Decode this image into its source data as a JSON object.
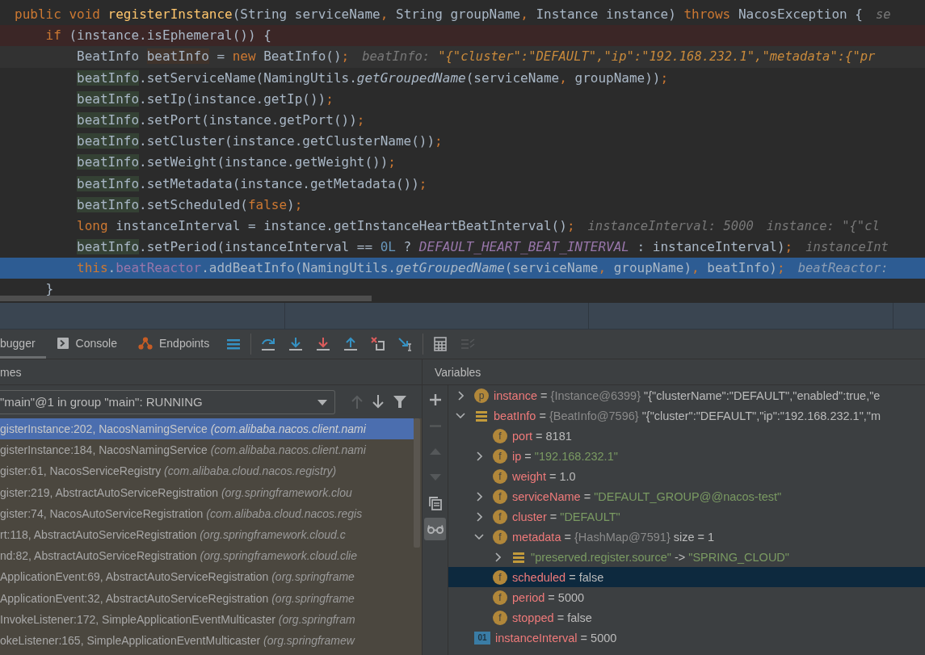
{
  "editor": {
    "lines": [
      {
        "tokens": [
          {
            "kind": "kw",
            "text": "public void "
          },
          {
            "kind": "fn",
            "text": "registerInstance"
          },
          {
            "kind": "plain",
            "text": "(String serviceName"
          },
          {
            "kind": "punct",
            "text": ", "
          },
          {
            "kind": "plain",
            "text": "String groupName"
          },
          {
            "kind": "punct",
            "text": ", "
          },
          {
            "kind": "plain",
            "text": "Instance instance) "
          },
          {
            "kind": "kw",
            "text": "throws "
          },
          {
            "kind": "plain",
            "text": "NacosException {"
          }
        ],
        "inlays": [
          {
            "text": "se"
          }
        ],
        "children": [
          {
            "kind": "breakpoint",
            "tokens": [
              {
                "kind": "kw",
                "text": "if "
              },
              {
                "kind": "plain",
                "text": "(instance.isEphemeral()) {"
              }
            ],
            "children": [
              {
                "kind": "caret",
                "tokens": [
                  {
                    "kind": "plain",
                    "text": "BeatInfo "
                  },
                  {
                    "kind": "decl",
                    "text": "beatInfo"
                  },
                  {
                    "kind": "plain",
                    "text": " = "
                  },
                  {
                    "kind": "kw",
                    "text": "new "
                  },
                  {
                    "kind": "plain",
                    "text": "BeatInfo()"
                  },
                  {
                    "kind": "punct",
                    "text": ";"
                  }
                ],
                "inlays": [
                  {
                    "text": "beatInfo:",
                    "value": "\"{\"cluster\":\"DEFAULT\",\"ip\":\"192.168.232.1\",\"metadata\":{\"pr"
                  }
                ]
              },
              {
                "tokens": [
                  {
                    "kind": "usage",
                    "text": "beatInfo"
                  },
                  {
                    "kind": "plain",
                    "text": ".setServiceName(NamingUtils."
                  },
                  {
                    "kind": "italic",
                    "text": "getGroupedName"
                  },
                  {
                    "kind": "plain",
                    "text": "(serviceName"
                  },
                  {
                    "kind": "punct",
                    "text": ", "
                  },
                  {
                    "kind": "plain",
                    "text": "groupName))"
                  },
                  {
                    "kind": "punct",
                    "text": ";"
                  }
                ]
              },
              {
                "tokens": [
                  {
                    "kind": "usage",
                    "text": "beatInfo"
                  },
                  {
                    "kind": "plain",
                    "text": ".setIp(instance.getIp())"
                  },
                  {
                    "kind": "punct",
                    "text": ";"
                  }
                ]
              },
              {
                "tokens": [
                  {
                    "kind": "usage",
                    "text": "beatInfo"
                  },
                  {
                    "kind": "plain",
                    "text": ".setPort(instance.getPort())"
                  },
                  {
                    "kind": "punct",
                    "text": ";"
                  }
                ]
              },
              {
                "tokens": [
                  {
                    "kind": "usage",
                    "text": "beatInfo"
                  },
                  {
                    "kind": "plain",
                    "text": ".setCluster(instance.getClusterName())"
                  },
                  {
                    "kind": "punct",
                    "text": ";"
                  }
                ]
              },
              {
                "tokens": [
                  {
                    "kind": "usage",
                    "text": "beatInfo"
                  },
                  {
                    "kind": "plain",
                    "text": ".setWeight(instance.getWeight())"
                  },
                  {
                    "kind": "punct",
                    "text": ";"
                  }
                ]
              },
              {
                "tokens": [
                  {
                    "kind": "usage",
                    "text": "beatInfo"
                  },
                  {
                    "kind": "plain",
                    "text": ".setMetadata(instance.getMetadata())"
                  },
                  {
                    "kind": "punct",
                    "text": ";"
                  }
                ]
              },
              {
                "tokens": [
                  {
                    "kind": "usage",
                    "text": "beatInfo"
                  },
                  {
                    "kind": "plain",
                    "text": ".setScheduled("
                  },
                  {
                    "kind": "kw",
                    "text": "false"
                  },
                  {
                    "kind": "plain",
                    "text": ")"
                  },
                  {
                    "kind": "punct",
                    "text": ";"
                  }
                ]
              },
              {
                "tokens": [
                  {
                    "kind": "kw",
                    "text": "long "
                  },
                  {
                    "kind": "plain",
                    "text": "instanceInterval = instance.getInstanceHeartBeatInterval()"
                  },
                  {
                    "kind": "punct",
                    "text": ";"
                  }
                ],
                "inlays": [
                  {
                    "text": "instanceInterval: 5000"
                  },
                  {
                    "text": "instance: \"{\"cl"
                  }
                ]
              },
              {
                "tokens": [
                  {
                    "kind": "usage",
                    "text": "beatInfo"
                  },
                  {
                    "kind": "plain",
                    "text": ".setPeriod(instanceInterval == "
                  },
                  {
                    "kind": "num",
                    "text": "0L"
                  },
                  {
                    "kind": "plain",
                    "text": " ? "
                  },
                  {
                    "kind": "const",
                    "text": "DEFAULT_HEART_BEAT_INTERVAL"
                  },
                  {
                    "kind": "plain",
                    "text": " : instanceInterval)"
                  },
                  {
                    "kind": "punct",
                    "text": ";"
                  }
                ],
                "inlays": [
                  {
                    "text": "instanceInt"
                  }
                ]
              },
              {
                "kind": "execution",
                "tokens": [
                  {
                    "kind": "kw",
                    "text": "this"
                  },
                  {
                    "kind": "plain",
                    "text": "."
                  },
                  {
                    "kind": "field",
                    "text": "beatReactor"
                  },
                  {
                    "kind": "plain",
                    "text": ".addBeatInfo(NamingUtils."
                  },
                  {
                    "kind": "italic",
                    "text": "getGroupedName"
                  },
                  {
                    "kind": "plain",
                    "text": "(serviceName"
                  },
                  {
                    "kind": "punct",
                    "text": ", "
                  },
                  {
                    "kind": "plain",
                    "text": "groupName)"
                  },
                  {
                    "kind": "punct",
                    "text": ", "
                  },
                  {
                    "kind": "plain",
                    "text": "beatInfo)"
                  },
                  {
                    "kind": "punct",
                    "text": ";"
                  }
                ],
                "inlays": [
                  {
                    "text": "beatReactor:"
                  }
                ]
              }
            ]
          },
          {
            "tokens": [
              {
                "kind": "plain",
                "text": "}"
              }
            ]
          }
        ]
      }
    ]
  },
  "debug_toolbar": {
    "tabs": [
      {
        "label": "bugger",
        "selected": true
      },
      {
        "label": "Console",
        "selected": false
      },
      {
        "label": "Endpoints",
        "selected": false
      }
    ],
    "tools": [
      {
        "kind": "menu",
        "disabled": false
      },
      {
        "kind": "step-over",
        "disabled": false
      },
      {
        "kind": "step-into",
        "disabled": false
      },
      {
        "kind": "force-step-into",
        "disabled": false
      },
      {
        "kind": "step-out",
        "disabled": false
      },
      {
        "kind": "drop-frame",
        "disabled": false
      },
      {
        "kind": "run-to-cursor",
        "disabled": false
      },
      {
        "kind": "calculator",
        "disabled": false
      },
      {
        "kind": "lines",
        "disabled": true
      }
    ]
  },
  "frames": {
    "title": "mes",
    "thread": "\"main\"@1 in group \"main\": RUNNING",
    "nav": [
      {
        "kind": "up",
        "disabled": true
      },
      {
        "kind": "down",
        "disabled": false
      },
      {
        "kind": "filter",
        "disabled": false
      }
    ],
    "items": [
      {
        "method": "gisterInstance:202, NacosNamingService",
        "package": "(com.alibaba.nacos.client.nami",
        "selected": true
      },
      {
        "method": "gisterInstance:184, NacosNamingService",
        "package": "(com.alibaba.nacos.client.nami",
        "selected": false
      },
      {
        "method": "gister:61, NacosServiceRegistry",
        "package": "(com.alibaba.cloud.nacos.registry)",
        "selected": false
      },
      {
        "method": "gister:219, AbstractAutoServiceRegistration",
        "package": "(org.springframework.clou",
        "selected": false
      },
      {
        "method": "gister:74, NacosAutoServiceRegistration",
        "package": "(com.alibaba.cloud.nacos.regis",
        "selected": false
      },
      {
        "method": "rt:118, AbstractAutoServiceRegistration",
        "package": "(org.springframework.cloud.c",
        "selected": false
      },
      {
        "method": "nd:82, AbstractAutoServiceRegistration",
        "package": "(org.springframework.cloud.clie",
        "selected": false
      },
      {
        "method": "ApplicationEvent:69, AbstractAutoServiceRegistration",
        "package": "(org.springframe",
        "selected": false
      },
      {
        "method": "ApplicationEvent:32, AbstractAutoServiceRegistration",
        "package": "(org.springframe",
        "selected": false
      },
      {
        "method": "InvokeListener:172, SimpleApplicationEventMulticaster",
        "package": "(org.springfram",
        "selected": false
      },
      {
        "method": "okeListener:165, SimpleApplicationEventMulticaster",
        "package": "(org.springframew",
        "selected": false
      }
    ]
  },
  "variables": {
    "title": "Variables",
    "side_tools": [
      {
        "kind": "plus",
        "disabled": false,
        "selected": false
      },
      {
        "kind": "minus",
        "disabled": true,
        "selected": false
      },
      {
        "kind": "up",
        "disabled": true,
        "selected": false
      },
      {
        "kind": "down",
        "disabled": true,
        "selected": false
      },
      {
        "kind": "copy",
        "disabled": false,
        "selected": false
      },
      {
        "kind": "glasses",
        "disabled": false,
        "selected": true
      }
    ],
    "items": [
      {
        "expandable": true,
        "expanded": false,
        "badge": {
          "kind": "circle",
          "text": "p"
        },
        "name": "instance",
        "string_name": false,
        "separator": "=",
        "ref": "{Instance@6399}",
        "value": "\"{\"clusterName\":\"DEFAULT\",\"enabled\":true,\"e",
        "string_value": false,
        "selected": false
      },
      {
        "expandable": true,
        "expanded": true,
        "badge": {
          "kind": "lines"
        },
        "name": "beatInfo",
        "string_name": false,
        "separator": "=",
        "ref": "{BeatInfo@7596}",
        "value": "\"{\"cluster\":\"DEFAULT\",\"ip\":\"192.168.232.1\",\"m",
        "string_value": false,
        "selected": false,
        "children": [
          {
            "expandable": false,
            "badge": {
              "kind": "circle",
              "text": "f"
            },
            "name": "port",
            "string_name": false,
            "separator": "=",
            "value": "8181",
            "string_value": false,
            "selected": false
          },
          {
            "expandable": true,
            "expanded": false,
            "badge": {
              "kind": "circle",
              "text": "f"
            },
            "name": "ip",
            "string_name": false,
            "separator": "=",
            "value": "\"192.168.232.1\"",
            "string_value": true,
            "selected": false
          },
          {
            "expandable": false,
            "badge": {
              "kind": "circle",
              "text": "f"
            },
            "name": "weight",
            "string_name": false,
            "separator": "=",
            "value": "1.0",
            "string_value": false,
            "selected": false
          },
          {
            "expandable": true,
            "expanded": false,
            "badge": {
              "kind": "circle",
              "text": "f"
            },
            "name": "serviceName",
            "string_name": false,
            "separator": "=",
            "value": "\"DEFAULT_GROUP@@nacos-test\"",
            "string_value": true,
            "selected": false
          },
          {
            "expandable": true,
            "expanded": false,
            "badge": {
              "kind": "circle",
              "text": "f"
            },
            "name": "cluster",
            "string_name": false,
            "separator": "=",
            "value": "\"DEFAULT\"",
            "string_value": true,
            "selected": false
          },
          {
            "expandable": true,
            "expanded": true,
            "badge": {
              "kind": "circle",
              "text": "f"
            },
            "name": "metadata",
            "string_name": false,
            "separator": "=",
            "ref": "{HashMap@7591}",
            "value": "size = 1",
            "string_value": false,
            "selected": false,
            "children": [
              {
                "expandable": true,
                "expanded": false,
                "badge": {
                  "kind": "lines"
                },
                "name": "\"preserved.register.source\"",
                "string_name": true,
                "separator": "->",
                "value": "\"SPRING_CLOUD\"",
                "string_value": true,
                "selected": false
              }
            ]
          },
          {
            "expandable": false,
            "badge": {
              "kind": "circle",
              "text": "f"
            },
            "name": "scheduled",
            "string_name": false,
            "separator": "=",
            "value": "false",
            "string_value": false,
            "selected": true
          },
          {
            "expandable": false,
            "badge": {
              "kind": "circle",
              "text": "f"
            },
            "name": "period",
            "string_name": false,
            "separator": "=",
            "value": "5000",
            "string_value": false,
            "selected": false
          },
          {
            "expandable": false,
            "badge": {
              "kind": "circle",
              "text": "f"
            },
            "name": "stopped",
            "string_name": false,
            "separator": "=",
            "value": "false",
            "string_value": false,
            "selected": false
          }
        ]
      },
      {
        "expandable": false,
        "badge": {
          "kind": "square",
          "text": "01"
        },
        "name": "instanceInterval",
        "string_name": false,
        "separator": "=",
        "value": "5000",
        "string_value": false,
        "selected": false
      }
    ]
  }
}
